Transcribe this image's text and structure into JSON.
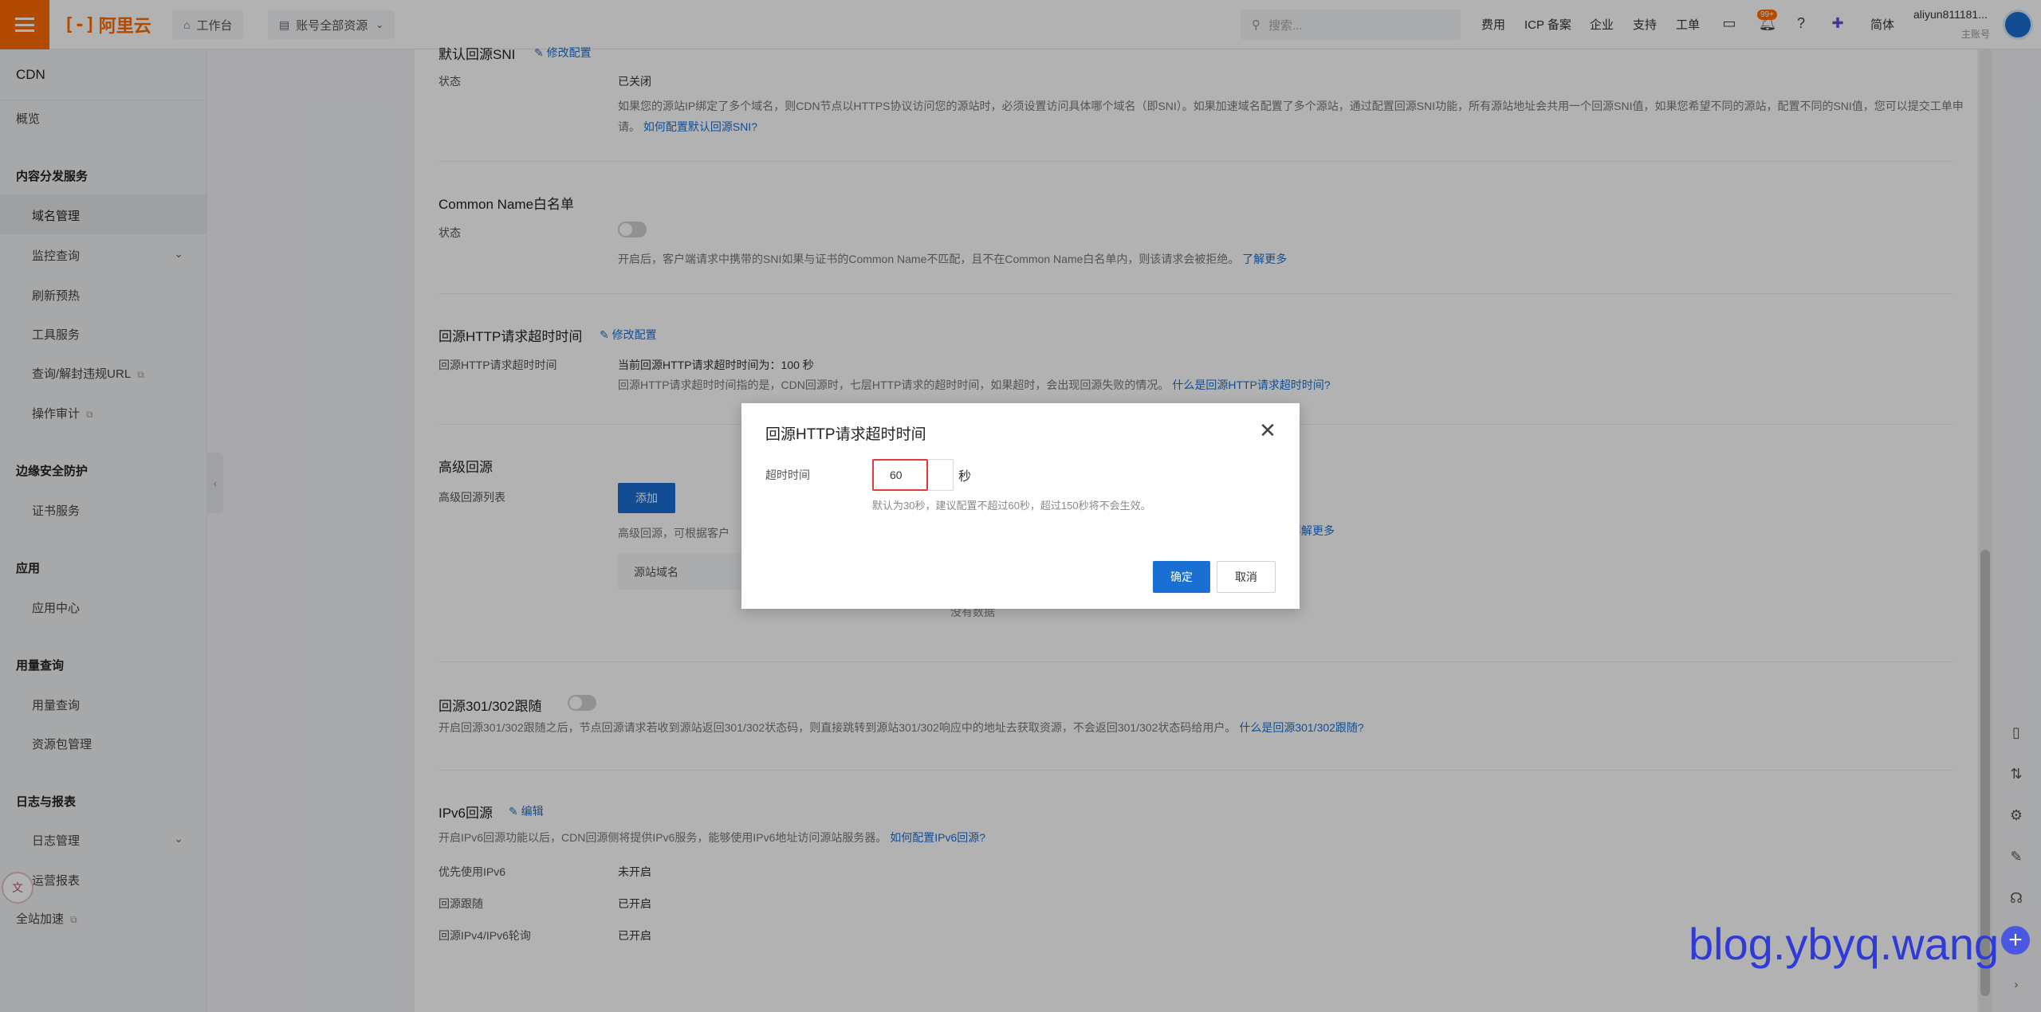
{
  "topbar": {
    "logo_mark": "[-]",
    "logo_text": "阿里云",
    "workbench": "工作台",
    "resources": "账号全部资源",
    "search_placeholder": "搜索...",
    "links": [
      "费用",
      "ICP 备案",
      "企业",
      "支持",
      "工单"
    ],
    "badge": "99+",
    "lang": "简体",
    "user_name": "aliyun811181...",
    "user_sub": "主账号"
  },
  "sidebar": {
    "title": "CDN",
    "overview": "概览",
    "group1": "内容分发服务",
    "items1": [
      "域名管理",
      "监控查询",
      "刷新预热",
      "工具服务",
      "查询/解封违规URL",
      "操作审计"
    ],
    "group2": "边缘安全防护",
    "items2": [
      "证书服务"
    ],
    "group3": "应用",
    "items3": [
      "应用中心"
    ],
    "group4": "用量查询",
    "items4": [
      "用量查询",
      "资源包管理"
    ],
    "group5": "日志与报表",
    "items5": [
      "日志管理",
      "运营报表"
    ],
    "bottom": "全站加速"
  },
  "main": {
    "sni_title": "默认回源SNI",
    "sni_edit": "修改配置",
    "sni_status_label": "状态",
    "sni_status_value": "已关闭",
    "sni_desc": "如果您的源站IP绑定了多个域名，则CDN节点以HTTPS协议访问您的源站时，必须设置访问具体哪个域名（即SNI）。如果加速域名配置了多个源站，通过配置回源SNI功能，所有源站地址会共用一个回源SNI值，如果您希望不同的源站，配置不同的SNI值，您可以提交工单申请。",
    "sni_link": "如何配置默认回源SNI?",
    "cn_title": "Common Name白名单",
    "cn_status_label": "状态",
    "cn_desc": "开启后，客户端请求中携带的SNI如果与证书的Common Name不匹配，且不在Common Name白名单内，则该请求会被拒绝。",
    "cn_link": "了解更多",
    "timeout_title": "回源HTTP请求超时时间",
    "timeout_edit": "修改配置",
    "timeout_label": "回源HTTP请求超时时间",
    "timeout_value": "当前回源HTTP请求超时时间为：100 秒",
    "timeout_desc": "回源HTTP请求超时时间指的是，CDN回源时，七层HTTP请求的超时时间，如果超时，会出现回源失败的情况。",
    "timeout_link": "什么是回源HTTP请求超时时间?",
    "adv_title": "高级回源",
    "adv_label": "高级回源列表",
    "adv_add": "添加",
    "adv_desc": "高级回源，可根据客户",
    "adv_more": "详解更多",
    "adv_col": "源站域名",
    "adv_nodata": "没有数据",
    "redirect_title": "回源301/302跟随",
    "redirect_desc": "开启回源301/302跟随之后，节点回源请求若收到源站返回301/302状态码，则直接跳转到源站301/302响应中的地址去获取资源，不会返回301/302状态码给用户。",
    "redirect_link": "什么是回源301/302跟随?",
    "ipv6_title": "IPv6回源",
    "ipv6_edit": "编辑",
    "ipv6_desc": "开启IPv6回源功能以后，CDN回源侧将提供IPv6服务，能够使用IPv6地址访问源站服务器。",
    "ipv6_link": "如何配置IPv6回源?",
    "ipv6_rows": [
      {
        "label": "优先使用IPv6",
        "value": "未开启"
      },
      {
        "label": "回源跟随",
        "value": "已开启"
      },
      {
        "label": "回源IPv4/IPv6轮询",
        "value": "已开启"
      }
    ]
  },
  "modal": {
    "title": "回源HTTP请求超时时间",
    "field_label": "超时时间",
    "input_value": "60",
    "unit": "秒",
    "hint": "默认为30秒，建议配置不超过60秒，超过150秒将不会生效。",
    "ok": "确定",
    "cancel": "取消"
  },
  "watermark": "blog.ybyq.wang"
}
